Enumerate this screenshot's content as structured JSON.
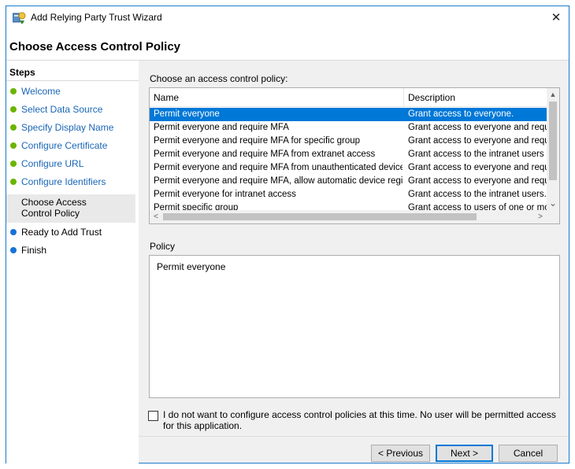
{
  "window": {
    "title": "Add Relying Party Trust Wizard",
    "close_glyph": "✕"
  },
  "header": {
    "title": "Choose Access Control Policy"
  },
  "steps": {
    "header": "Steps",
    "items": [
      {
        "label": "Welcome",
        "state": "done"
      },
      {
        "label": "Select Data Source",
        "state": "done"
      },
      {
        "label": "Specify Display Name",
        "state": "done"
      },
      {
        "label": "Configure Certificate",
        "state": "done"
      },
      {
        "label": "Configure URL",
        "state": "done"
      },
      {
        "label": "Configure Identifiers",
        "state": "done"
      },
      {
        "label": "Choose Access Control Policy",
        "state": "current"
      },
      {
        "label": "Ready to Add Trust",
        "state": "todo"
      },
      {
        "label": "Finish",
        "state": "todo"
      }
    ]
  },
  "policy_list": {
    "label": "Choose an access control policy:",
    "columns": [
      "Name",
      "Description"
    ],
    "rows": [
      {
        "name": "Permit everyone",
        "description": "Grant access to everyone.",
        "selected": true
      },
      {
        "name": "Permit everyone and require MFA",
        "description": "Grant access to everyone and requir"
      },
      {
        "name": "Permit everyone and require MFA for specific group",
        "description": "Grant access to everyone and requir"
      },
      {
        "name": "Permit everyone and require MFA from extranet access",
        "description": "Grant access to the intranet users ar"
      },
      {
        "name": "Permit everyone and require MFA from unauthenticated devices",
        "description": "Grant access to everyone and requir"
      },
      {
        "name": "Permit everyone and require MFA, allow automatic device registr...",
        "description": "Grant access to everyone and requir"
      },
      {
        "name": "Permit everyone for intranet access",
        "description": "Grant access to the intranet users."
      },
      {
        "name": "Permit specific group",
        "description": "Grant access to users of one or more"
      }
    ],
    "scroll_up_glyph": "▲",
    "scroll_down_glyph": "⌄",
    "scroll_left_glyph": "<",
    "scroll_right_glyph": ">"
  },
  "policy_detail": {
    "label": "Policy",
    "text": "Permit everyone"
  },
  "opt_out": {
    "checked": false,
    "label": "I do not want to configure access control policies at this time. No user will be permitted access for this application."
  },
  "buttons": {
    "previous": "< Previous",
    "next": "Next >",
    "cancel": "Cancel"
  },
  "colors": {
    "accent": "#0078d7",
    "step_done": "#6bb400",
    "step_todo": "#1872d6",
    "link": "#1a66b7"
  },
  "icons": {
    "app": "relying-party-trust-icon",
    "close": "close-icon",
    "step_done": "green-dot-icon",
    "step_todo": "blue-dot-icon"
  }
}
